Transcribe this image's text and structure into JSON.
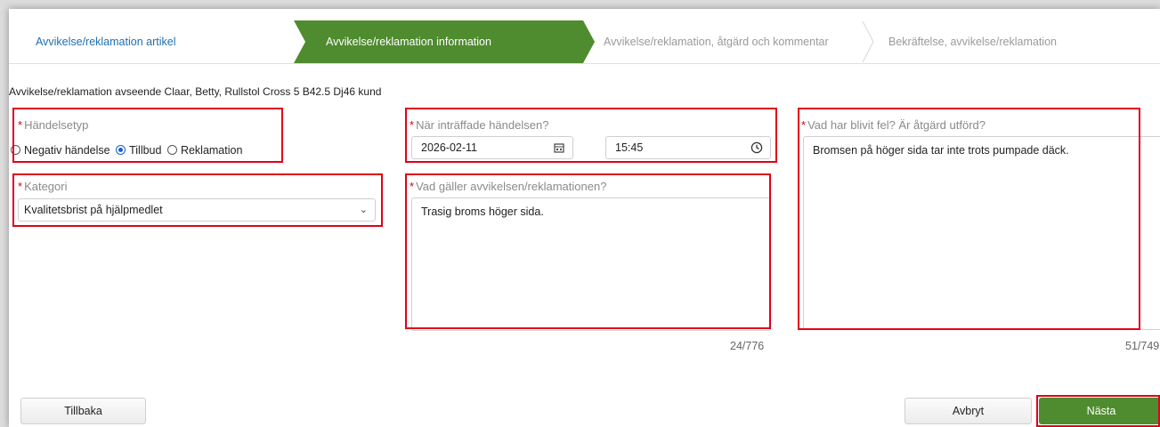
{
  "wizard": {
    "steps": [
      {
        "label": "Avvikelse/reklamation artikel"
      },
      {
        "label": "Avvikelse/reklamation information"
      },
      {
        "label": "Avvikelse/reklamation, åtgärd och kommentar"
      },
      {
        "label": "Bekräftelse, avvikelse/reklamation"
      }
    ]
  },
  "subject": "Avvikelse/reklamation avseende Claar, Betty, Rullstol Cross 5 B42.5 Dj46 kund",
  "form": {
    "required_mark": "*",
    "event_type": {
      "label": "Händelsetyp",
      "options": [
        "Negativ händelse",
        "Tillbud",
        "Reklamation"
      ],
      "selected": "Tillbud"
    },
    "category": {
      "label": "Kategori",
      "value": "Kvalitetsbrist på hjälpmedlet"
    },
    "when": {
      "label": "När inträffade händelsen?",
      "date": "2026-02-11",
      "time": "15:45"
    },
    "concerns": {
      "label": "Vad gäller avvikelsen/reklamationen?",
      "value": "Trasig broms höger sida.",
      "counter": "24/776"
    },
    "whats_wrong": {
      "label": "Vad har blivit fel? Är åtgärd utförd?",
      "value": "Bromsen på höger sida tar inte trots pumpade däck.",
      "counter": "51/749"
    }
  },
  "buttons": {
    "back": "Tillbaka",
    "cancel": "Avbryt",
    "next": "Nästa"
  },
  "colors": {
    "accent": "#4f8b2f",
    "link": "#1f6fb0",
    "highlight": "#e0001b",
    "required": "#d0021b"
  }
}
